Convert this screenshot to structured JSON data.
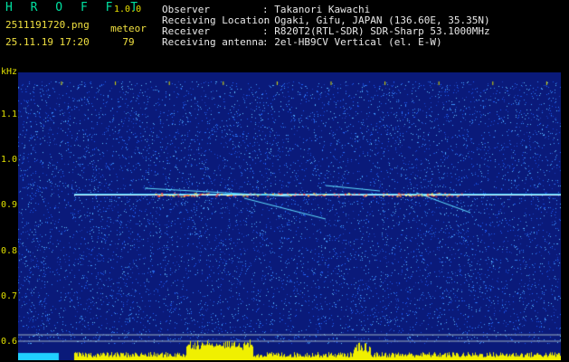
{
  "app": {
    "title": "H R O F F T",
    "version": "1.0.0"
  },
  "file": {
    "name": "2511191720.png",
    "datetime": "25.11.19 17:20"
  },
  "detection": {
    "label": "meteor",
    "count": "79"
  },
  "info": {
    "observer_label": "Observer",
    "observer_value": ": Takanori Kawachi",
    "location_label": "Receiving Location",
    "location_value": ": Ogaki, Gifu, JAPAN (136.60E, 35.35N)",
    "receiver_label": "Receiver",
    "receiver_value": ": R820T2(RTL-SDR) SDR-Sharp 53.1000MHz",
    "antenna_label": "Receiving antenna",
    "antenna_value": ": 2el-HB9CV Vertical (el. E-W)"
  },
  "spectrogram": {
    "y_unit": "kHz",
    "x_ticks": [
      "1721",
      "1722",
      "1723",
      "1724",
      "1725",
      "1726",
      "1727",
      "1728",
      "1729",
      "1730"
    ],
    "y_ticks": [
      "1.1",
      "1.0",
      "0.9",
      "0.8",
      "0.7",
      "0.6"
    ],
    "carrier_khz": 0.925,
    "colors": {
      "background": "#0a1a7a",
      "noise": "#2060ff",
      "carrier": "#40d0ff",
      "hot": "#ff4040",
      "meter": "#f0f000",
      "meter_base": "#20d0ff"
    }
  }
}
